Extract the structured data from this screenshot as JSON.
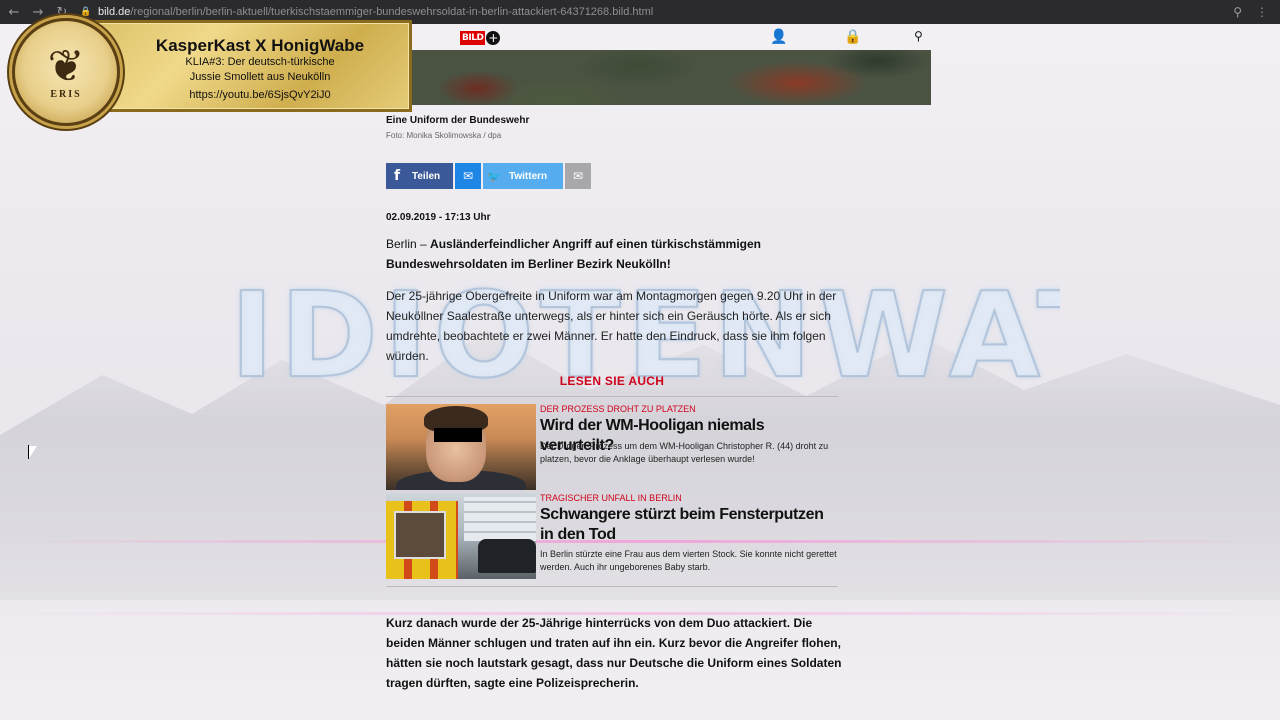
{
  "browser": {
    "url_host": "bild.de",
    "url_path": "/regional/berlin/berlin-aktuell/tuerkischstaemmiger-bundeswehrsoldat-in-berlin-attackiert-64371268.bild.html",
    "back_icon": "←",
    "forward_icon": "→",
    "reload_icon": "↻",
    "lock_icon": "🔒",
    "zoom_icon": "⚲",
    "more_icon": "⋮"
  },
  "overlay": {
    "title": "KasperKast X HonigWabe",
    "line1": "KLIA#3: Der deutsch-türkische",
    "line2": "Jussie Smollett aus Neukölln",
    "line3": "https://youtu.be/6SjsQvY2iJ0",
    "logo_wings": "❦",
    "logo_text": "ERIS"
  },
  "background": {
    "watermark": "IDIOTENWATCH"
  },
  "site": {
    "bild_label": "BILD",
    "plus_label": "+",
    "account_icon": "👤",
    "lock_icon": "🔒",
    "search_icon": "⚲"
  },
  "article": {
    "caption": "Eine Uniform der Bundeswehr",
    "credit": "Foto: Monika Skolimowska / dpa",
    "share": {
      "facebook_label": "Teilen",
      "facebook_icon": "f",
      "messenger_icon": "✉",
      "twitter_label": "Twittern",
      "twitter_icon": "🐦",
      "mail_icon": "✉"
    },
    "date": "02.09.2019 - 17:13 Uhr",
    "lead_prefix": "Berlin – ",
    "lead_bold": "Ausländerfeindlicher Angriff auf einen türkischstämmigen Bundeswehrsoldaten im Berliner Bezirk Neukölln!",
    "para1": "Der 25-jährige Obergefreite in Uniform war am Montagmorgen gegen 9.20 Uhr in der Neuköllner Saalestraße unterwegs, als er hinter sich ein Geräusch hörte. Als er sich umdrehte, beobachtete er zwei Männer. Er hatte den Eindruck, dass sie ihm folgen würden.",
    "read_also": "LESEN SIE AUCH",
    "teasers": [
      {
        "kicker": "DER PROZESS DROHT ZU PLATZEN",
        "headline": "Wird der WM-Hooligan niemals verurteilt?",
        "desc": "Der Drogen-Prozess um dem WM-Hooligan Christopher R. (44) droht zu platzen, bevor die Anklage überhaupt verlesen wurde!"
      },
      {
        "kicker": "TRAGISCHER UNFALL IN BERLIN",
        "headline": "Schwangere stürzt beim Fensterputzen in den Tod",
        "desc": "In Berlin stürzte eine Frau aus dem vierten Stock. Sie konnte nicht gerettet werden. Auch ihr ungeborenes Baby starb."
      }
    ],
    "para2": "Kurz danach wurde der 25-Jährige hinterrücks von dem Duo attackiert. Die beiden Männer schlugen und traten auf ihn ein. Kurz bevor die Angreifer flohen, hätten sie noch lautstark gesagt, dass nur Deutsche die Uniform eines Soldaten tragen dürften, sagte eine Polizeisprecherin."
  }
}
